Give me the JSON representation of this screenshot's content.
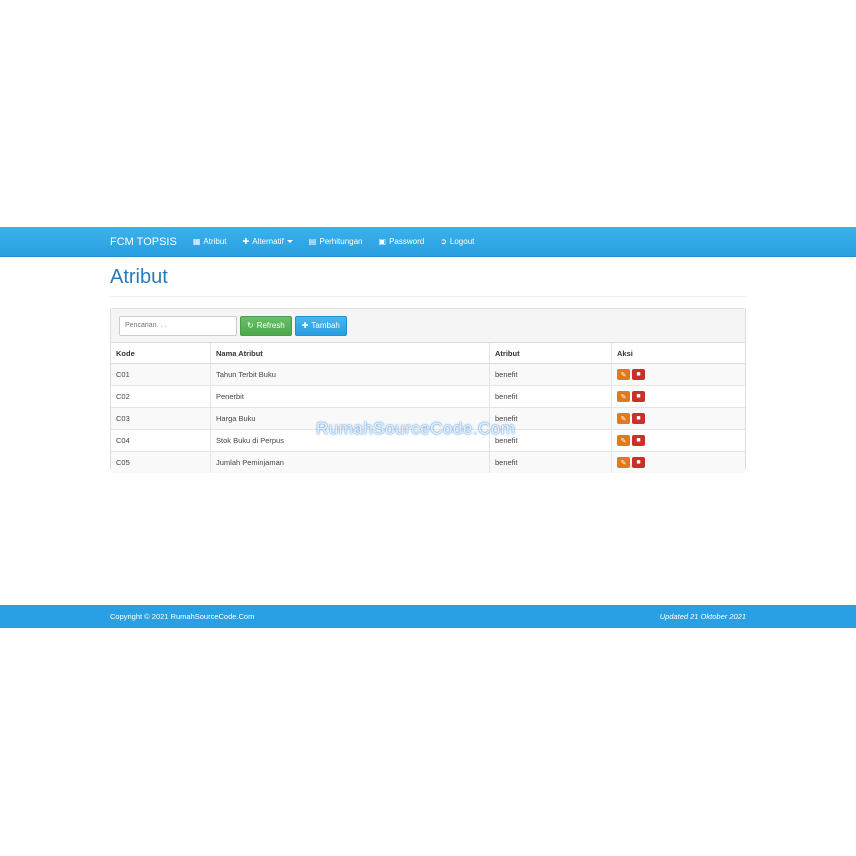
{
  "navbar": {
    "brand": "FCM TOPSIS",
    "items": [
      {
        "label": "Atribut",
        "icon": "grid-icon"
      },
      {
        "label": "Alternatif",
        "icon": "plus-icon"
      },
      {
        "label": "Perhitungan",
        "icon": "calendar-icon"
      },
      {
        "label": "Password",
        "icon": "lock-icon"
      },
      {
        "label": "Logout",
        "icon": "logout-icon"
      }
    ]
  },
  "page": {
    "title": "Atribut"
  },
  "toolbar": {
    "search_placeholder": "Pencarian. . .",
    "refresh_label": "Refresh",
    "add_label": "Tambah"
  },
  "table": {
    "headers": [
      "Kode",
      "Nama Atribut",
      "Atribut",
      "Aksi"
    ],
    "rows": [
      {
        "kode": "C01",
        "nama": "Tahun Terbit Buku",
        "atribut": "benefit"
      },
      {
        "kode": "C02",
        "nama": "Penerbit",
        "atribut": "benefit"
      },
      {
        "kode": "C03",
        "nama": "Harga Buku",
        "atribut": "benefit"
      },
      {
        "kode": "C04",
        "nama": "Stok Buku di Perpus",
        "atribut": "benefit"
      },
      {
        "kode": "C05",
        "nama": "Jumlah Peminjaman",
        "atribut": "benefit"
      }
    ]
  },
  "watermark": "RumahSourceCode.Com",
  "footer": {
    "copyright": "Copyright © 2021 RumahSourceCode.Com",
    "updated": "Updated 21 Oktober 2021"
  },
  "colors": {
    "navbar": "#2a9fe0",
    "title": "#2a7ab8",
    "refresh_button": "#5cb85c",
    "add_button": "#2a9de0",
    "edit_action": "#e07a1f",
    "delete_action": "#c9302c",
    "footer": "#2aa0e4"
  }
}
